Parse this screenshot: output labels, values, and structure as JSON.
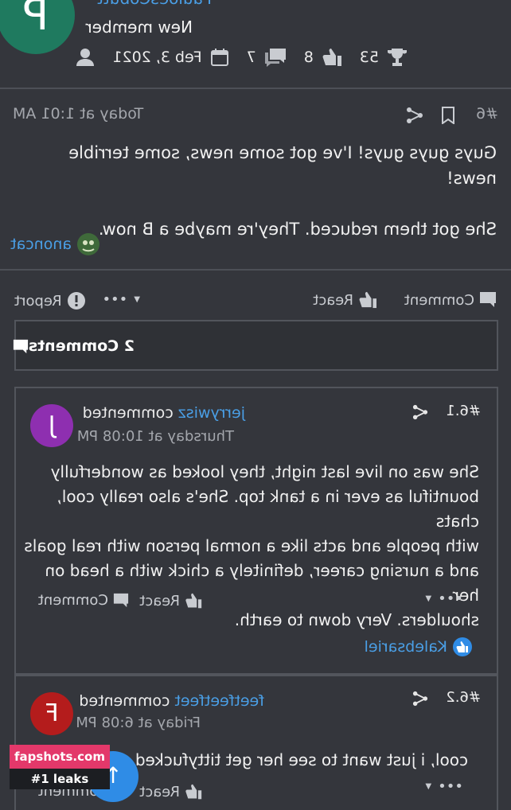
{
  "author": {
    "avatar_letter": "P",
    "name": "PauloesCobutt",
    "role": "New member",
    "joined": "Feb 3, 2021",
    "messages": "7",
    "reactions": "8",
    "points": "53"
  },
  "post": {
    "time": "Today at 1:01 AM",
    "number": "#6",
    "paragraphs": [
      "Guys guys guys! I've got some news, some terrible news!",
      "She got them reduced. They're maybe a B now."
    ],
    "reactor": "anoncat"
  },
  "actions": {
    "report": "Report",
    "more": "•••",
    "react": "React",
    "comment": "Comment"
  },
  "comments_header": "2 Comments",
  "comments": [
    {
      "avatar_letter": "J",
      "avatar_color": "#8e2fb0",
      "user": "jerrywisz",
      "verb": "commented",
      "time": "Thursday at 10:08 PM",
      "number": "#6.1",
      "lines": [
        "She was on live last night, they looked as wonderfully",
        "bountiful as ever in a tank top. She's also really cool, chats",
        "with people and acts like a normal person with real goals",
        "and a nursing career, definitely a chick with a head on her",
        "shoulders. Very down to earth."
      ],
      "reactor": "Kalebsariel"
    },
    {
      "avatar_letter": "F",
      "avatar_color": "#b41c1c",
      "user": "feetfeetfeet",
      "verb": "commented",
      "time": "Friday at 6:08 PM",
      "number": "#6.2",
      "lines": [
        "cool, i just want to see her get tittyfucked"
      ]
    }
  ],
  "watermark": {
    "line1": "fapshots.com",
    "line2": "#1 leaks"
  },
  "colors": {
    "background": "#34363c",
    "link": "#4a9fe6",
    "fab": "#2f8ce6"
  }
}
